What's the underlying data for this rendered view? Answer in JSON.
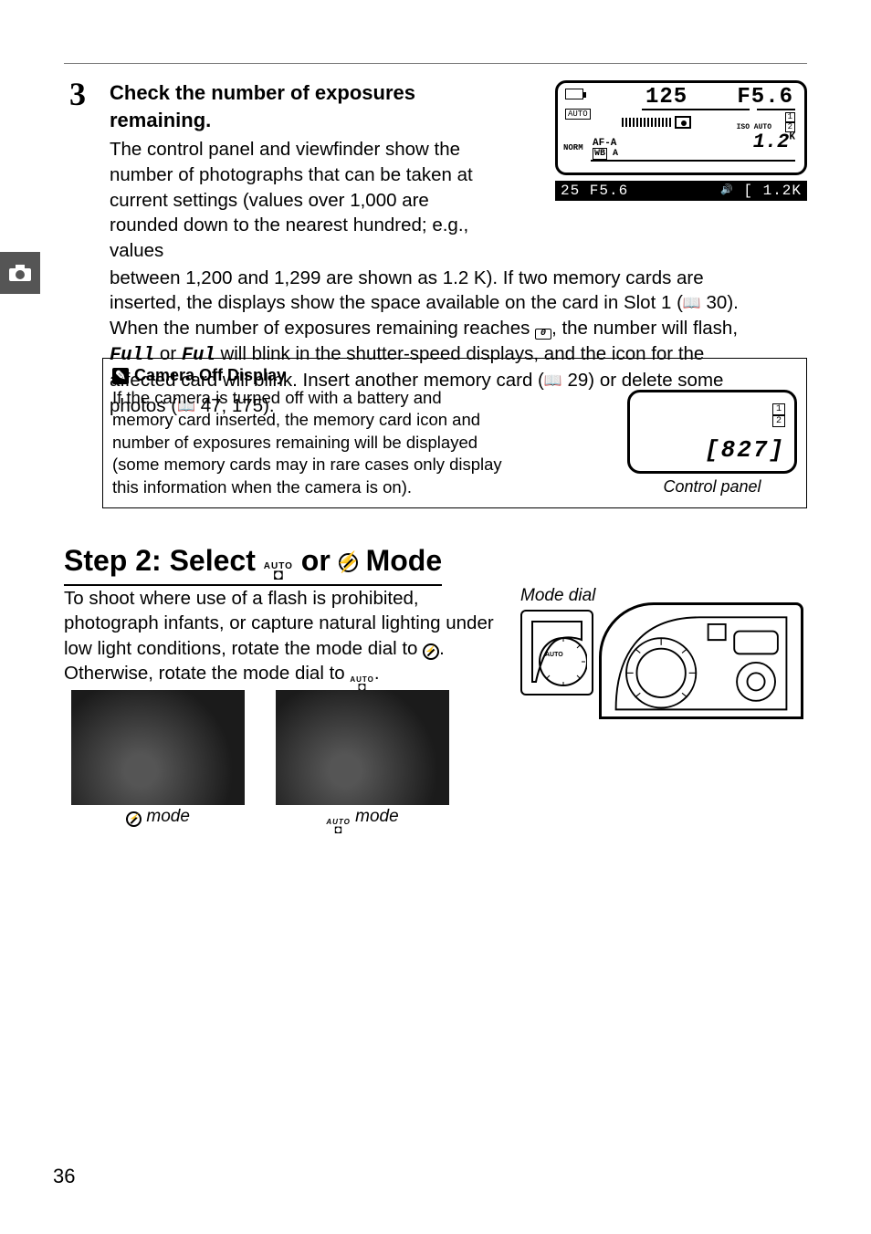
{
  "page_number": "36",
  "step": {
    "number": "3",
    "title": "Check the number of exposures remaining.",
    "para1": "The control panel and viewfinder show the number of photographs that can be taken at current settings (values over 1,000 are rounded down to the nearest hundred; e.g., values",
    "para2a": "between 1,200 and 1,299 are shown as 1.2 K).  If two memory cards are inserted, the displays show the space available on the card in Slot 1 (",
    "para2b": " 30).  When the number of exposures remaining reaches ",
    "para2c": ", the number will flash, ",
    "para2d": " or ",
    "para2e": " will blink in the shutter-speed displays, and the icon for the affected card will blink.  Insert another memory card (",
    "para2f": " 29) or delete some photos (",
    "para2g": " 47, 175).",
    "zero": "0",
    "full4": "Full",
    "full3": "Ful"
  },
  "lcd": {
    "shutter": "125",
    "fnumber": "F5.6",
    "auto": "AUTO",
    "norm": "NORM",
    "afa": "AF-A",
    "wb_a": "A",
    "wb": "WB",
    "iso_auto": "ISO  AUTO",
    "frames": "1.2",
    "frames_k": "K",
    "slot1": "1",
    "slot2": "2",
    "view_left": "25  F5.6",
    "view_right": "1.2K"
  },
  "note": {
    "title": "Camera Off Display",
    "body": "If the camera is turned off with a battery and memory card inserted, the memory card icon and number of exposures remaining will be displayed (some memory cards may in rare cases only display this information when the camera is on).",
    "caption": "Control panel",
    "slot1": "1",
    "slot2": "2",
    "frames": "[827]"
  },
  "section": {
    "title_a": "Step 2: Select ",
    "title_b": " or ",
    "title_c": " Mode",
    "para_a": "To shoot where use of a flash is prohibited, photograph infants, or capture natural lighting under low light conditions, rotate the mode dial to ",
    "para_b": ". Otherwise, rotate the mode dial to ",
    "para_c": ".",
    "auto_top": "AUTO",
    "mode_dial": "Mode dial",
    "caption1": " mode",
    "caption2": " mode"
  }
}
